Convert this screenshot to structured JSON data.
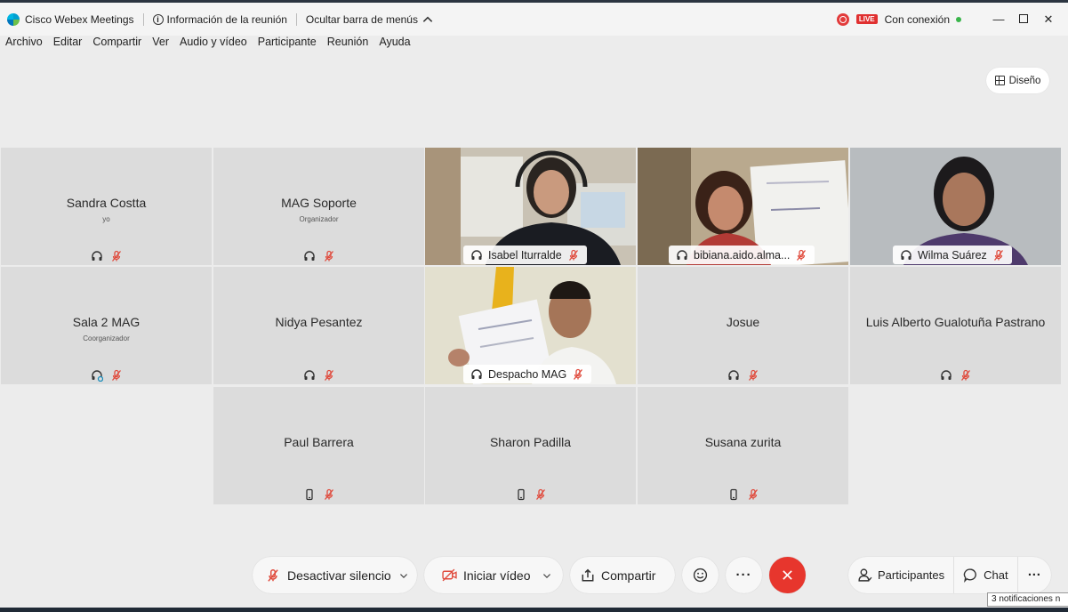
{
  "titlebar": {
    "app_name": "Cisco Webex Meetings",
    "meeting_info": "Información de la reunión",
    "hide_menu": "Ocultar barra de menús",
    "live": "LIVE",
    "connection": "Con conexión"
  },
  "menu": [
    "Archivo",
    "Editar",
    "Compartir",
    "Ver",
    "Audio y vídeo",
    "Participante",
    "Reunión",
    "Ayuda"
  ],
  "layout_button": "Diseño",
  "participants": [
    {
      "name": "Sandra Costta",
      "role": "yo",
      "icon": "headphone-icon"
    },
    {
      "name": "MAG Soporte",
      "role": "Organizador",
      "icon": "headphone-icon"
    },
    {
      "name": "Isabel Iturralde",
      "role": "",
      "icon": "headphone-icon"
    },
    {
      "name": "bibiana.aido.alma...",
      "role": "",
      "icon": "headphone-icon"
    },
    {
      "name": "Wilma Suárez",
      "role": "",
      "icon": "headphone-icon"
    },
    {
      "name": "Sala 2 MAG",
      "role": "Coorganizador",
      "icon": "headphone-sync-icon"
    },
    {
      "name": "Nidya Pesantez",
      "role": "",
      "icon": "headphone-icon"
    },
    {
      "name": "Despacho MAG",
      "role": "",
      "icon": "headphone-icon"
    },
    {
      "name": "Josue",
      "role": "",
      "icon": "headphone-icon"
    },
    {
      "name": "Luis Alberto Gualotuña Pastrano",
      "role": "",
      "icon": "headphone-icon"
    },
    {
      "name": "Paul Barrera",
      "role": "",
      "icon": "phone-icon"
    },
    {
      "name": "Sharon Padilla",
      "role": "",
      "icon": "phone-icon"
    },
    {
      "name": "Susana zurita",
      "role": "",
      "icon": "phone-icon"
    }
  ],
  "controls": {
    "unmute": "Desactivar silencio",
    "start_video": "Iniciar vídeo",
    "share": "Compartir",
    "participants": "Participantes",
    "chat": "Chat",
    "more": "···"
  },
  "tooltip": "3 notificaciones n",
  "colors": {
    "muted_mic": "#e04a3c",
    "end_call": "#e7362d",
    "tile_bg": "#dcdcdc",
    "window_bg": "#ececec"
  }
}
